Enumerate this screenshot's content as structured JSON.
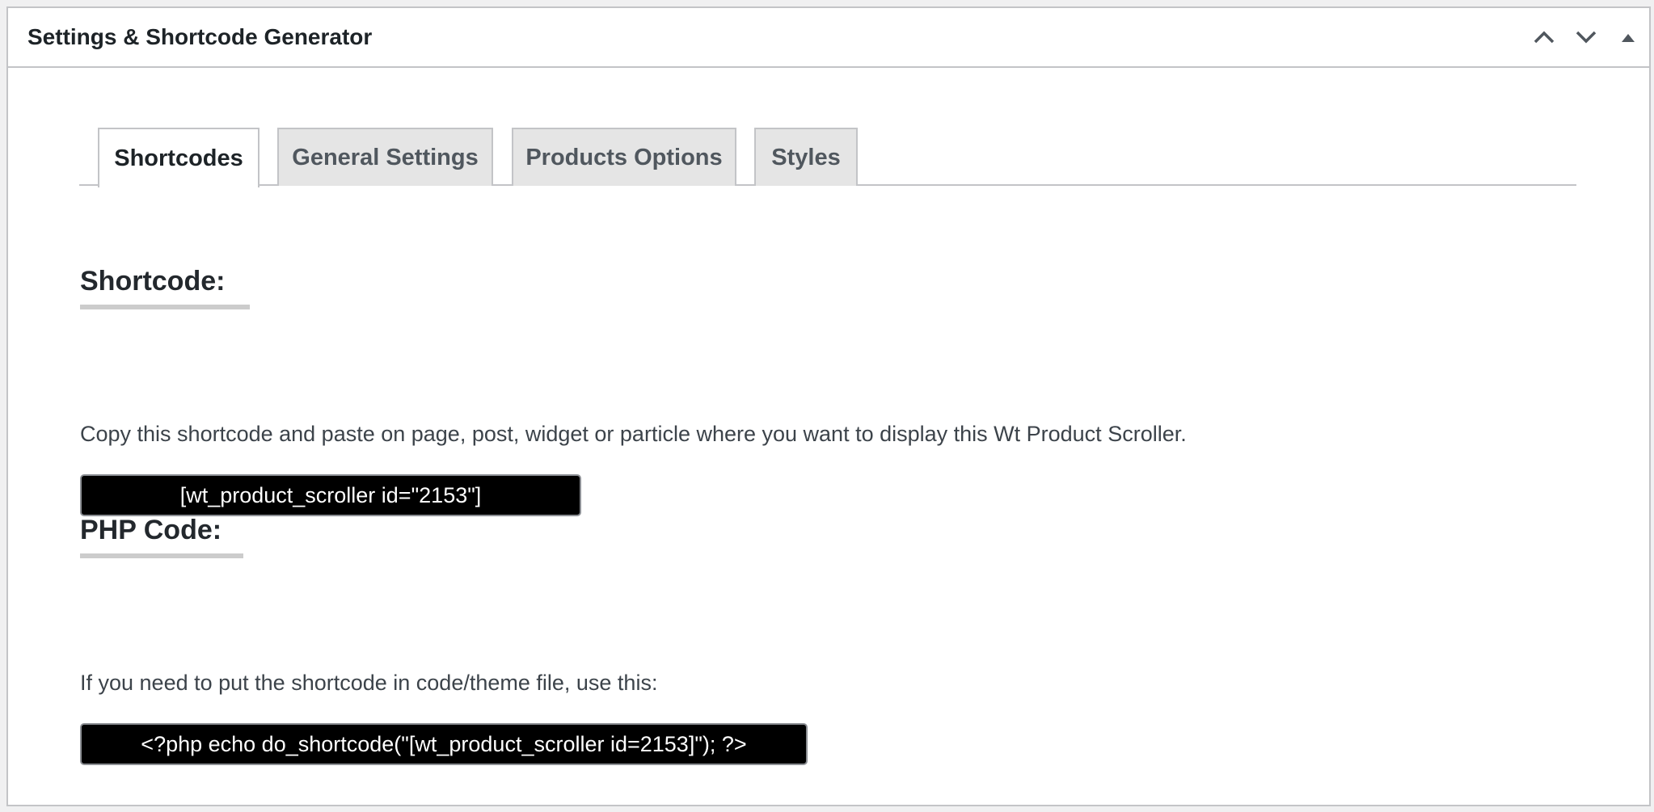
{
  "postbox": {
    "title": "Settings & Shortcode Generator",
    "controls": [
      {
        "icon": "chevron-up-icon",
        "label": "Move up"
      },
      {
        "icon": "chevron-down-icon",
        "label": "Move down"
      },
      {
        "icon": "triangle-up-icon",
        "label": "Toggle panel"
      }
    ]
  },
  "tabs": [
    {
      "label": "Shortcodes",
      "active": true
    },
    {
      "label": "General Settings",
      "active": false
    },
    {
      "label": "Products Options",
      "active": false
    },
    {
      "label": "Styles",
      "active": false
    }
  ],
  "shortcode_section": {
    "heading": "Shortcode:",
    "description": "Copy this shortcode and paste on page, post, widget or particle where you want to display this Wt Product Scroller.",
    "value": "[wt_product_scroller id=\"2153\"]"
  },
  "php_section": {
    "heading": "PHP Code:",
    "description": "If you need to put the shortcode in code/theme file, use this:",
    "value": "<?php echo do_shortcode(\"[wt_product_scroller id=2153]\"); ?>"
  },
  "colors": {
    "code_background": "#000000",
    "code_text": "#ffffff",
    "border": "#c3c4c7",
    "inactive_tab": "#e5e5e5"
  }
}
